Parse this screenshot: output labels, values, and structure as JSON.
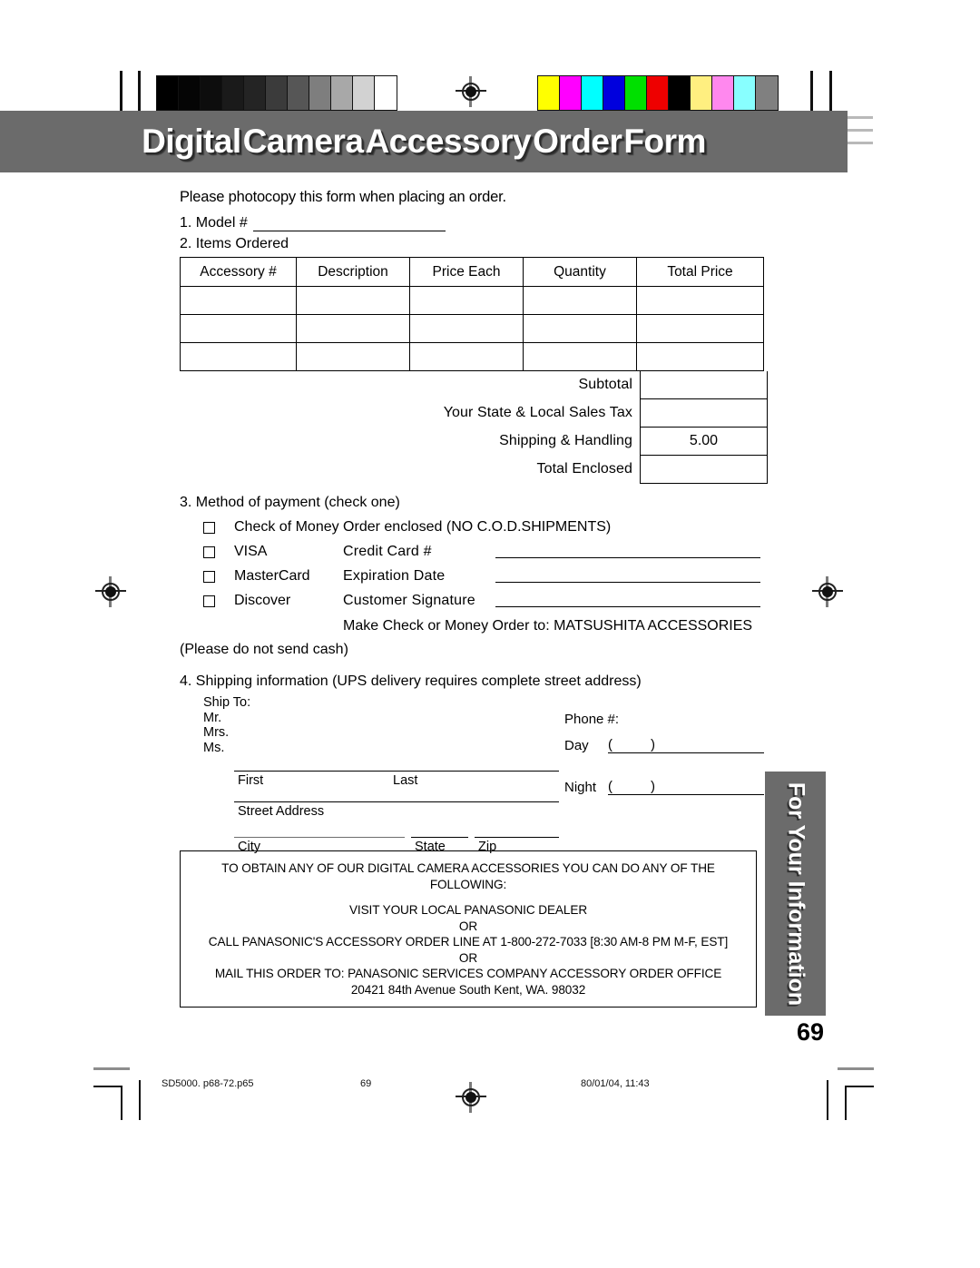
{
  "header": {
    "title_words": [
      "Digital",
      "Camera",
      "Accessory",
      "Order",
      "Form"
    ],
    "band_color": "#6b6b6b"
  },
  "calibration": {
    "gray_strip": [
      "#000000",
      "#050505",
      "#0d0d0d",
      "#1a1a1a",
      "#242424",
      "#3b3b3b",
      "#565656",
      "#7e7e7e",
      "#a8a8a8",
      "#d2d2d2",
      "#ffffff"
    ],
    "color_strip": [
      "#ffff00",
      "#ff00ff",
      "#00ffff",
      "#0000dd",
      "#00e000",
      "#ee0000",
      "#000000",
      "#ffef80",
      "#ff88ee",
      "#88ffff",
      "#808080"
    ]
  },
  "intro": {
    "lead": "Please photocopy this form when placing an order.",
    "model_line": "1. Model #",
    "items_line": "2. Items Ordered"
  },
  "items_table": {
    "columns": [
      "Accessory #",
      "Description",
      "Price Each",
      "Quantity",
      "Total Price"
    ],
    "rows": [
      [
        "",
        "",
        "",
        "",
        ""
      ],
      [
        "",
        "",
        "",
        "",
        ""
      ],
      [
        "",
        "",
        "",
        "",
        ""
      ]
    ]
  },
  "totals": [
    {
      "label": "Subtotal",
      "value": ""
    },
    {
      "label": "Your State & Local Sales Tax",
      "value": ""
    },
    {
      "label": "Shipping  &  Handling",
      "value": "5.00"
    },
    {
      "label": "Total  Enclosed",
      "value": ""
    }
  ],
  "payment": {
    "heading": "3. Method of payment (check one)",
    "options": [
      {
        "checkbox_label": "Check of Money Order enclosed (NO C.O.D.SHIPMENTS)",
        "field_label": ""
      },
      {
        "checkbox_label": "VISA",
        "field_label": "Credit Card #"
      },
      {
        "checkbox_label": "MasterCard",
        "field_label": "Expiration  Date"
      },
      {
        "checkbox_label": "Discover",
        "field_label": "Customer  Signature"
      }
    ],
    "make_check": "Make Check or Money Order to: MATSUSHITA ACCESSORIES",
    "no_cash": "(Please do not send cash)"
  },
  "shipping": {
    "heading": "4. Shipping information (UPS delivery requires complete street address)",
    "ship_to": "Ship To:",
    "titles": [
      "Mr.",
      "Mrs.",
      "Ms."
    ],
    "captions": {
      "first": "First",
      "last": "Last",
      "street": "Street  Address",
      "city": "City",
      "state": "State",
      "zip": "Zip"
    },
    "phone": {
      "heading": "Phone #:",
      "day_label": "Day",
      "night_label": "Night",
      "paren_open": "(",
      "paren_close": ")"
    }
  },
  "info_box": {
    "lines": [
      "TO OBTAIN ANY OF OUR DIGITAL CAMERA ACCESSORIES YOU CAN DO ANY OF THE",
      "FOLLOWING:",
      "VISIT YOUR LOCAL PANASONIC DEALER",
      "OR",
      "CALL PANASONIC'S ACCESSORY ORDER LINE AT 1-800-272-7033 [8:30 AM-8 PM M-F, EST]",
      "OR",
      "MAIL THIS ORDER TO: PANASONIC SERVICES COMPANY ACCESSORY ORDER OFFICE",
      "20421 84th Avenue South Kent, WA. 98032"
    ]
  },
  "side_tab": {
    "text": "For Your  Information"
  },
  "page_number": "69",
  "footer": {
    "file": "SD5000. p68-72.p65",
    "page": "69",
    "timestamp": "80/01/04, 11:43"
  }
}
